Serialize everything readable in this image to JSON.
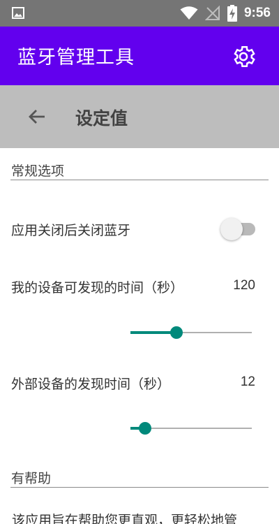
{
  "status_bar": {
    "time": "9:56",
    "icons": [
      "image-icon",
      "wifi-icon",
      "no-signal-icon",
      "battery-charging-icon"
    ]
  },
  "app_bar": {
    "title": "蓝牙管理工具",
    "settings_icon": "gear-icon",
    "color": "#6200ee"
  },
  "sub_bar": {
    "back_icon": "arrow-left-icon",
    "title": "设定值"
  },
  "sections": {
    "general": {
      "header": "常规选项"
    },
    "help": {
      "header": "有帮助"
    }
  },
  "settings": {
    "close_bt": {
      "label": "应用关闭后关闭蓝牙",
      "enabled": false
    },
    "my_discoverable": {
      "label": "我的设备可发现的时间（秒）",
      "value": "120",
      "fraction": 0.38
    },
    "ext_discovery": {
      "label": "外部设备的发现时间（秒）",
      "value": "12",
      "fraction": 0.12
    }
  },
  "help_text": "该应用旨在帮助您更直观，更轻松地管",
  "accent_color": "#00897b"
}
